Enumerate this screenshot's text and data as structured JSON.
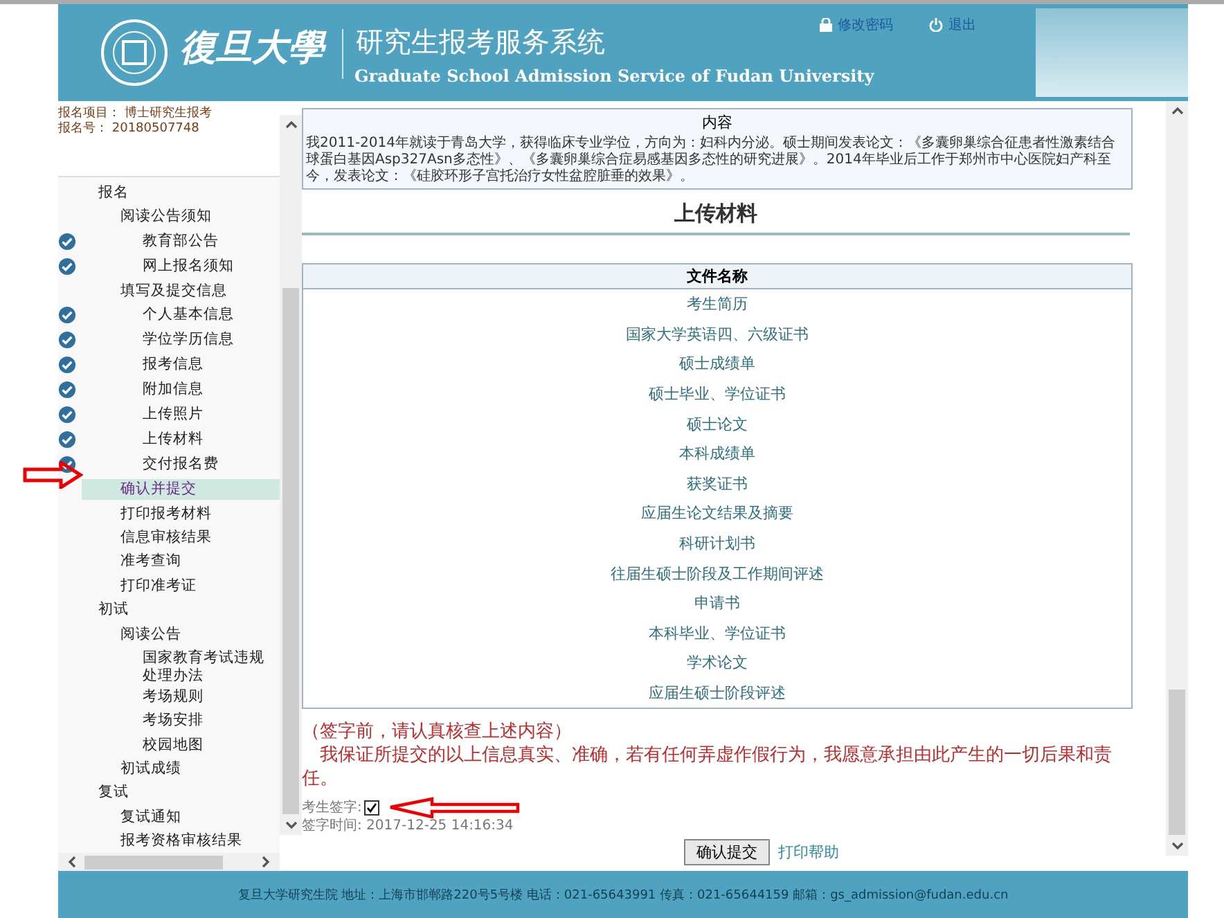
{
  "header": {
    "logo_text": "復旦大學",
    "system_title": "研究生报考服务系统",
    "system_subtitle": "Graduate School Admission Service of Fudan University",
    "links": [
      {
        "kind": "lock",
        "label": "修改密码"
      },
      {
        "kind": "power",
        "label": "退出"
      }
    ]
  },
  "sidebar": {
    "info": [
      {
        "label": "报名项目：",
        "value": "博士研究生报考"
      },
      {
        "label": "报名号：",
        "value": "20180507748"
      }
    ],
    "items": [
      {
        "label": "报名",
        "checked": false,
        "selected": false,
        "children": [
          {
            "label": "阅读公告须知",
            "checked": false,
            "selected": false,
            "children": [
              {
                "label": "教育部公告",
                "checked": true,
                "selected": false
              },
              {
                "label": "网上报名须知",
                "checked": true,
                "selected": false
              }
            ]
          },
          {
            "label": "填写及提交信息",
            "checked": false,
            "selected": false,
            "children": [
              {
                "label": "个人基本信息",
                "checked": true,
                "selected": false
              },
              {
                "label": "学位学历信息",
                "checked": true,
                "selected": false
              },
              {
                "label": "报考信息",
                "checked": true,
                "selected": false
              },
              {
                "label": "附加信息",
                "checked": true,
                "selected": false
              },
              {
                "label": "上传照片",
                "checked": true,
                "selected": false
              },
              {
                "label": "上传材料",
                "checked": true,
                "selected": false
              },
              {
                "label": "交付报名费",
                "checked": true,
                "selected": false
              }
            ]
          },
          {
            "label": "确认并提交",
            "checked": false,
            "selected": true
          },
          {
            "label": "打印报考材料",
            "checked": false,
            "selected": false
          },
          {
            "label": "信息审核结果",
            "checked": false,
            "selected": false
          },
          {
            "label": "准考查询",
            "checked": false,
            "selected": false
          },
          {
            "label": "打印准考证",
            "checked": false,
            "selected": false
          }
        ]
      },
      {
        "label": "初试",
        "checked": false,
        "selected": false,
        "children": [
          {
            "label": "阅读公告",
            "checked": false,
            "selected": false,
            "children": [
              {
                "label": "国家教育考试违规处理办法",
                "checked": false,
                "selected": false
              },
              {
                "label": "考场规则",
                "checked": false,
                "selected": false
              },
              {
                "label": "考场安排",
                "checked": false,
                "selected": false
              },
              {
                "label": "校园地图",
                "checked": false,
                "selected": false
              }
            ]
          },
          {
            "label": "初试成绩",
            "checked": false,
            "selected": false
          }
        ]
      },
      {
        "label": "复试",
        "checked": false,
        "selected": false,
        "children": [
          {
            "label": "复试通知",
            "checked": false,
            "selected": false
          },
          {
            "label": "报考资格审核结果",
            "checked": false,
            "selected": false
          }
        ]
      }
    ]
  },
  "content_box": {
    "title": "内容",
    "text": "我2011-2014年就读于青岛大学，获得临床专业学位，方向为：妇科内分泌。硕士期间发表论文：《多囊卵巢综合征患者性激素结合球蛋白基因Asp327Asn多态性》、《多囊卵巢综合症易感基因多态性的研究进展》。2014年毕业后工作于郑州市中心医院妇产科至今，发表论文：《硅胶环形子宫托治疗女性盆腔脏垂的效果》。"
  },
  "section_title": "上传材料",
  "files": {
    "column": "文件名称",
    "rows": [
      "考生简历",
      "国家大学英语四、六级证书",
      "硕士成绩单",
      "硕士毕业、学位证书",
      "硕士论文",
      "本科成绩单",
      "获奖证书",
      "应届生论文结果及摘要",
      "科研计划书",
      "往届生硕士阶段及工作期间评述",
      "申请书",
      "本科毕业、学位证书",
      "学术论文",
      "应届生硕士阶段评述"
    ]
  },
  "declaration": {
    "note": "（签字前，请认真核查上述内容）",
    "statement": "我保证所提交的以上信息真实、准确，若有任何弄虚作假行为，我愿意承担由此产生的一切后果和责任。"
  },
  "signature": {
    "label": "考生签字:",
    "checked": true,
    "time_label": "签字时间:",
    "time": "2017-12-25 14:16:34"
  },
  "actions": {
    "submit": "确认提交",
    "help": "打印帮助"
  },
  "footer": "复旦大学研究生院 地址：上海市邯郸路220号5号楼 电话：021-65643991 传真：021-65644159 邮箱：gs_admission@fudan.edu.cn"
}
